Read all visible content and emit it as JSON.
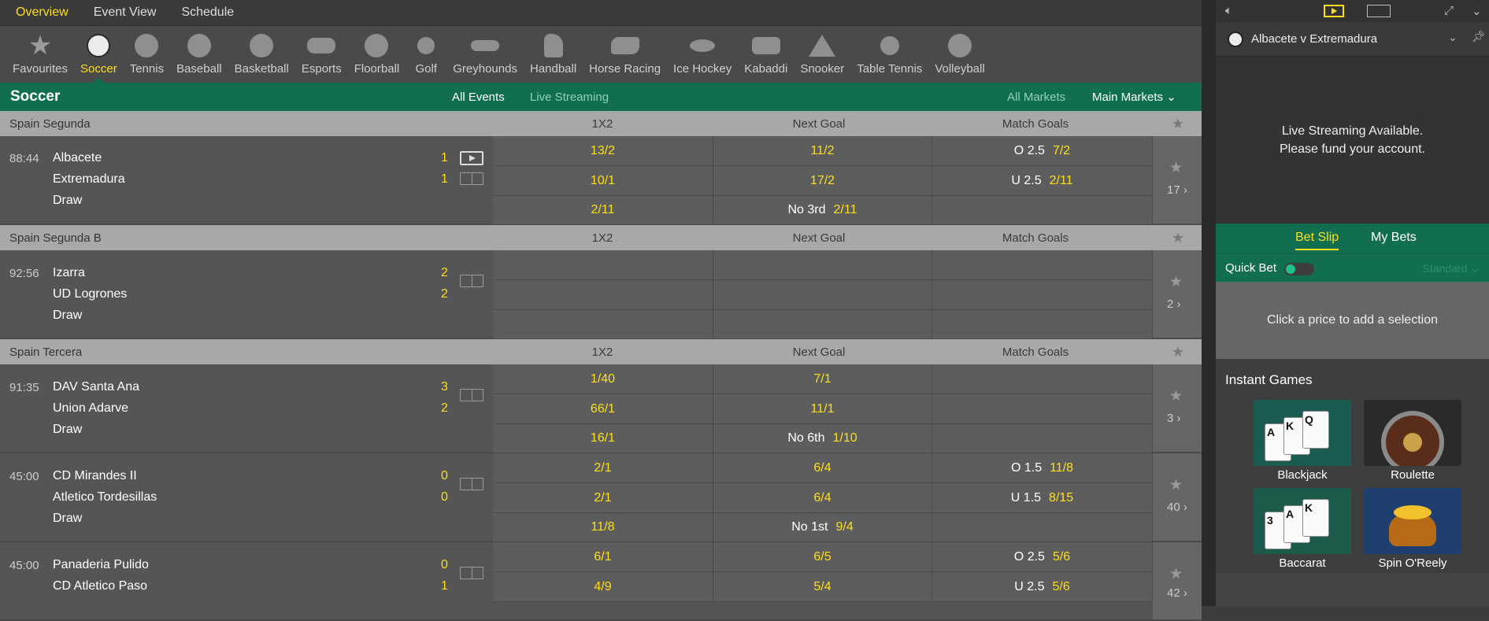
{
  "topnav": [
    "Overview",
    "Event View",
    "Schedule"
  ],
  "sports": [
    {
      "label": "Favourites",
      "icon": "star-icon"
    },
    {
      "label": "Soccer",
      "icon": "soccer-ball-icon"
    },
    {
      "label": "Tennis",
      "icon": "tennis-ball-icon"
    },
    {
      "label": "Baseball",
      "icon": "baseball-icon"
    },
    {
      "label": "Basketball",
      "icon": "basketball-icon"
    },
    {
      "label": "Esports",
      "icon": "gamepad-icon"
    },
    {
      "label": "Floorball",
      "icon": "floorball-icon"
    },
    {
      "label": "Golf",
      "icon": "golf-ball-icon"
    },
    {
      "label": "Greyhounds",
      "icon": "greyhound-icon"
    },
    {
      "label": "Handball",
      "icon": "handball-icon"
    },
    {
      "label": "Horse Racing",
      "icon": "horse-racing-icon"
    },
    {
      "label": "Ice Hockey",
      "icon": "hockey-puck-icon"
    },
    {
      "label": "Kabaddi",
      "icon": "kabaddi-icon"
    },
    {
      "label": "Snooker",
      "icon": "snooker-balls-icon"
    },
    {
      "label": "Table Tennis",
      "icon": "table-tennis-icon"
    },
    {
      "label": "Volleyball",
      "icon": "volleyball-icon"
    }
  ],
  "header": {
    "title": "Soccer",
    "all_events": "All Events",
    "live_streaming": "Live Streaming",
    "all_markets": "All Markets",
    "main_markets": "Main Markets"
  },
  "columns": {
    "c1": "1X2",
    "c2": "Next Goal",
    "c3": "Match Goals"
  },
  "leagues": [
    {
      "name": "Spain Segunda"
    },
    {
      "name": "Spain Segunda B"
    },
    {
      "name": "Spain Tercera"
    }
  ],
  "matches": [
    {
      "time": "88:44",
      "home": "Albacete",
      "away": "Extremadura",
      "draw": "Draw",
      "home_score": "1",
      "away_score": "1",
      "odds": [
        {
          "c1": "13/2",
          "c2": "11/2",
          "c3_label": "O 2.5",
          "c3": "7/2"
        },
        {
          "c1": "10/1",
          "c2": "17/2",
          "c3_label": "U 2.5",
          "c3": "2/11"
        },
        {
          "c1": "2/11",
          "c2_label": "No 3rd",
          "c2": "2/11"
        }
      ],
      "markets": "17 ›"
    },
    {
      "time": "92:56",
      "home": "Izarra",
      "away": "UD Logrones",
      "draw": "Draw",
      "home_score": "2",
      "away_score": "2",
      "markets": "2 ›"
    },
    {
      "time": "91:35",
      "home": "DAV Santa Ana",
      "away": "Union Adarve",
      "draw": "Draw",
      "home_score": "3",
      "away_score": "2",
      "odds": [
        {
          "c1": "1/40",
          "c2": "7/1"
        },
        {
          "c1": "66/1",
          "c2": "11/1"
        },
        {
          "c1": "16/1",
          "c2_label": "No 6th",
          "c2": "1/10"
        }
      ],
      "markets": "3 ›"
    },
    {
      "time": "45:00",
      "home": "CD Mirandes II",
      "away": "Atletico Tordesillas",
      "draw": "Draw",
      "home_score": "0",
      "away_score": "0",
      "odds": [
        {
          "c1": "2/1",
          "c2": "6/4",
          "c3_label": "O 1.5",
          "c3": "11/8"
        },
        {
          "c1": "2/1",
          "c2": "6/4",
          "c3_label": "U 1.5",
          "c3": "8/15"
        },
        {
          "c1": "11/8",
          "c2_label": "No 1st",
          "c2": "9/4"
        }
      ],
      "markets": "40 ›"
    },
    {
      "time": "45:00",
      "home": "Panaderia Pulido",
      "away": "CD Atletico Paso",
      "home_score": "0",
      "away_score": "1",
      "odds": [
        {
          "c1": "6/1",
          "c2": "6/5",
          "c3_label": "O 2.5",
          "c3": "5/6"
        },
        {
          "c1": "4/9",
          "c2": "5/4",
          "c3_label": "U 2.5",
          "c3": "5/6"
        }
      ],
      "markets": "42 ›"
    }
  ],
  "right": {
    "match_title": "Albacete v Extremadura",
    "stream_line1": "Live Streaming Available.",
    "stream_line2": "Please fund your account.",
    "bet_slip": "Bet Slip",
    "my_bets": "My Bets",
    "quick_bet": "Quick Bet",
    "standard": "Standard",
    "empty_msg": "Click a price to add a selection",
    "instant_games": "Instant Games",
    "games": [
      "Blackjack",
      "Roulette",
      "Baccarat",
      "Spin O'Reely"
    ]
  },
  "colors": {
    "accent": "#ffdf1b",
    "green": "#126e51"
  }
}
